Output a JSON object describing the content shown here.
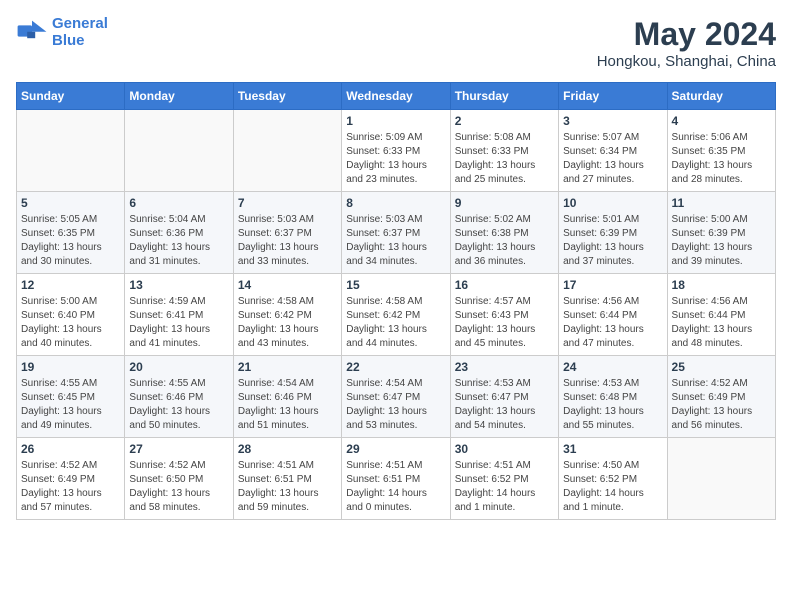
{
  "logo": {
    "line1": "General",
    "line2": "Blue"
  },
  "title": "May 2024",
  "subtitle": "Hongkou, Shanghai, China",
  "weekdays": [
    "Sunday",
    "Monday",
    "Tuesday",
    "Wednesday",
    "Thursday",
    "Friday",
    "Saturday"
  ],
  "weeks": [
    [
      {
        "day": "",
        "info": ""
      },
      {
        "day": "",
        "info": ""
      },
      {
        "day": "",
        "info": ""
      },
      {
        "day": "1",
        "info": "Sunrise: 5:09 AM\nSunset: 6:33 PM\nDaylight: 13 hours\nand 23 minutes."
      },
      {
        "day": "2",
        "info": "Sunrise: 5:08 AM\nSunset: 6:33 PM\nDaylight: 13 hours\nand 25 minutes."
      },
      {
        "day": "3",
        "info": "Sunrise: 5:07 AM\nSunset: 6:34 PM\nDaylight: 13 hours\nand 27 minutes."
      },
      {
        "day": "4",
        "info": "Sunrise: 5:06 AM\nSunset: 6:35 PM\nDaylight: 13 hours\nand 28 minutes."
      }
    ],
    [
      {
        "day": "5",
        "info": "Sunrise: 5:05 AM\nSunset: 6:35 PM\nDaylight: 13 hours\nand 30 minutes."
      },
      {
        "day": "6",
        "info": "Sunrise: 5:04 AM\nSunset: 6:36 PM\nDaylight: 13 hours\nand 31 minutes."
      },
      {
        "day": "7",
        "info": "Sunrise: 5:03 AM\nSunset: 6:37 PM\nDaylight: 13 hours\nand 33 minutes."
      },
      {
        "day": "8",
        "info": "Sunrise: 5:03 AM\nSunset: 6:37 PM\nDaylight: 13 hours\nand 34 minutes."
      },
      {
        "day": "9",
        "info": "Sunrise: 5:02 AM\nSunset: 6:38 PM\nDaylight: 13 hours\nand 36 minutes."
      },
      {
        "day": "10",
        "info": "Sunrise: 5:01 AM\nSunset: 6:39 PM\nDaylight: 13 hours\nand 37 minutes."
      },
      {
        "day": "11",
        "info": "Sunrise: 5:00 AM\nSunset: 6:39 PM\nDaylight: 13 hours\nand 39 minutes."
      }
    ],
    [
      {
        "day": "12",
        "info": "Sunrise: 5:00 AM\nSunset: 6:40 PM\nDaylight: 13 hours\nand 40 minutes."
      },
      {
        "day": "13",
        "info": "Sunrise: 4:59 AM\nSunset: 6:41 PM\nDaylight: 13 hours\nand 41 minutes."
      },
      {
        "day": "14",
        "info": "Sunrise: 4:58 AM\nSunset: 6:42 PM\nDaylight: 13 hours\nand 43 minutes."
      },
      {
        "day": "15",
        "info": "Sunrise: 4:58 AM\nSunset: 6:42 PM\nDaylight: 13 hours\nand 44 minutes."
      },
      {
        "day": "16",
        "info": "Sunrise: 4:57 AM\nSunset: 6:43 PM\nDaylight: 13 hours\nand 45 minutes."
      },
      {
        "day": "17",
        "info": "Sunrise: 4:56 AM\nSunset: 6:44 PM\nDaylight: 13 hours\nand 47 minutes."
      },
      {
        "day": "18",
        "info": "Sunrise: 4:56 AM\nSunset: 6:44 PM\nDaylight: 13 hours\nand 48 minutes."
      }
    ],
    [
      {
        "day": "19",
        "info": "Sunrise: 4:55 AM\nSunset: 6:45 PM\nDaylight: 13 hours\nand 49 minutes."
      },
      {
        "day": "20",
        "info": "Sunrise: 4:55 AM\nSunset: 6:46 PM\nDaylight: 13 hours\nand 50 minutes."
      },
      {
        "day": "21",
        "info": "Sunrise: 4:54 AM\nSunset: 6:46 PM\nDaylight: 13 hours\nand 51 minutes."
      },
      {
        "day": "22",
        "info": "Sunrise: 4:54 AM\nSunset: 6:47 PM\nDaylight: 13 hours\nand 53 minutes."
      },
      {
        "day": "23",
        "info": "Sunrise: 4:53 AM\nSunset: 6:47 PM\nDaylight: 13 hours\nand 54 minutes."
      },
      {
        "day": "24",
        "info": "Sunrise: 4:53 AM\nSunset: 6:48 PM\nDaylight: 13 hours\nand 55 minutes."
      },
      {
        "day": "25",
        "info": "Sunrise: 4:52 AM\nSunset: 6:49 PM\nDaylight: 13 hours\nand 56 minutes."
      }
    ],
    [
      {
        "day": "26",
        "info": "Sunrise: 4:52 AM\nSunset: 6:49 PM\nDaylight: 13 hours\nand 57 minutes."
      },
      {
        "day": "27",
        "info": "Sunrise: 4:52 AM\nSunset: 6:50 PM\nDaylight: 13 hours\nand 58 minutes."
      },
      {
        "day": "28",
        "info": "Sunrise: 4:51 AM\nSunset: 6:51 PM\nDaylight: 13 hours\nand 59 minutes."
      },
      {
        "day": "29",
        "info": "Sunrise: 4:51 AM\nSunset: 6:51 PM\nDaylight: 14 hours\nand 0 minutes."
      },
      {
        "day": "30",
        "info": "Sunrise: 4:51 AM\nSunset: 6:52 PM\nDaylight: 14 hours\nand 1 minute."
      },
      {
        "day": "31",
        "info": "Sunrise: 4:50 AM\nSunset: 6:52 PM\nDaylight: 14 hours\nand 1 minute."
      },
      {
        "day": "",
        "info": ""
      }
    ]
  ]
}
